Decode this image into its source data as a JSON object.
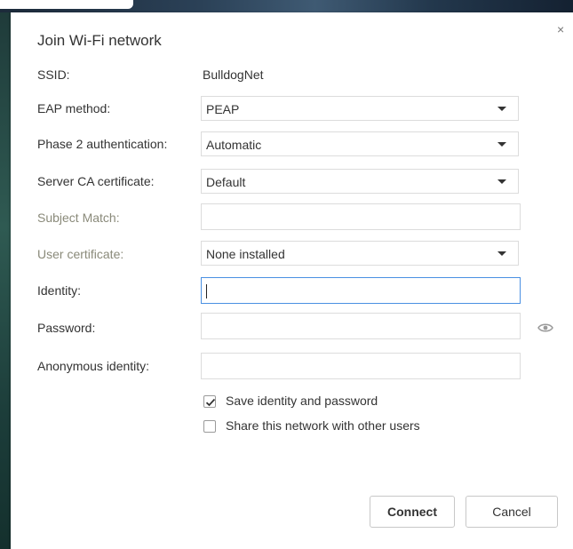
{
  "dialog": {
    "title": "Join Wi-Fi network",
    "close_symbol": "×"
  },
  "fields": {
    "ssid": {
      "label": "SSID:",
      "value": "BulldogNet"
    },
    "eap_method": {
      "label": "EAP method:",
      "value": "PEAP"
    },
    "phase2_auth": {
      "label": "Phase 2 authentication:",
      "value": "Automatic"
    },
    "server_ca": {
      "label": "Server CA certificate:",
      "value": "Default"
    },
    "subject_match": {
      "label": "Subject Match:",
      "value": ""
    },
    "user_cert": {
      "label": "User certificate:",
      "value": "None installed"
    },
    "identity": {
      "label": "Identity:",
      "value": ""
    },
    "password": {
      "label": "Password:",
      "value": ""
    },
    "anon_identity": {
      "label": "Anonymous identity:",
      "value": ""
    }
  },
  "options": {
    "save_identity": {
      "label": "Save identity and password",
      "checked": true
    },
    "share_network": {
      "label": "Share this network with other users",
      "checked": false
    }
  },
  "buttons": {
    "connect": "Connect",
    "cancel": "Cancel"
  },
  "icons": {
    "close": "close-icon",
    "caret": "chevron-down-icon",
    "show_password": "eye-icon",
    "checkmark": "checkmark-icon"
  },
  "colors": {
    "focus_border": "#4a90e2",
    "disabled_label": "#8a8a7a",
    "text": "#333333"
  }
}
